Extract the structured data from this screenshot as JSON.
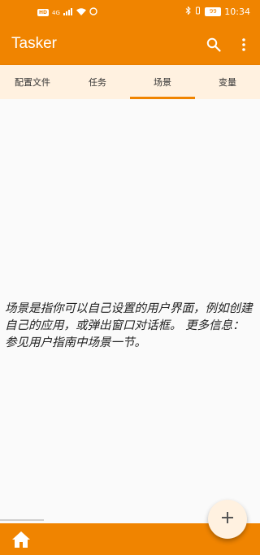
{
  "status_bar": {
    "network_badge": "HD",
    "network_type": "4G",
    "battery": "99",
    "time": "10:34"
  },
  "app_bar": {
    "title": "Tasker",
    "icons": [
      "search-icon",
      "more-vert-icon"
    ]
  },
  "tabs": [
    {
      "label": "配置文件",
      "active": false
    },
    {
      "label": "任务",
      "active": false
    },
    {
      "label": "场景",
      "active": true
    },
    {
      "label": "变量",
      "active": false
    }
  ],
  "content": {
    "empty_message": "场景是指你可以自己设置的用户界面，例如创建自己的应用，或弹出窗口对话框。 更多信息：参见用户指南中场景一节。"
  },
  "bottom_bar": {
    "home_icon": "home-icon"
  },
  "fab": {
    "icon": "plus-icon"
  },
  "colors": {
    "primary": "#f08400",
    "tab_background": "#fff1e0",
    "content_background": "#fafafa"
  }
}
